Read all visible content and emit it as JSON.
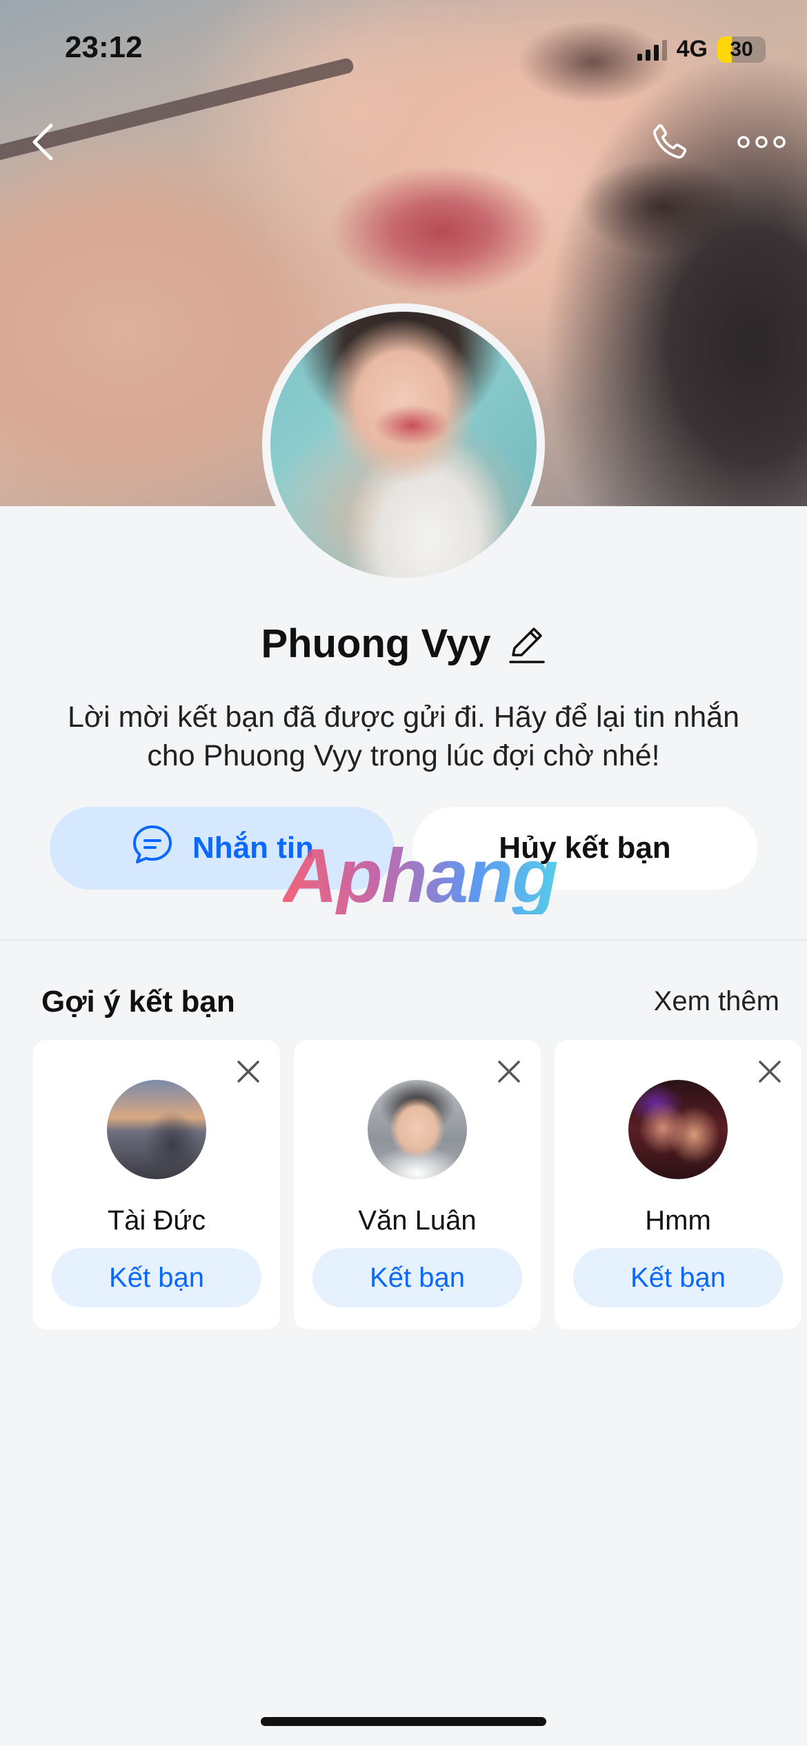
{
  "status_bar": {
    "time": "23:12",
    "network": "4G",
    "battery": "30"
  },
  "profile": {
    "name": "Phuong Vyy",
    "message": "Lời mời kết bạn đã được gửi đi. Hãy để lại tin nhắn cho Phuong Vyy trong lúc đợi chờ nhé!",
    "message_button_label": "Nhắn tin",
    "unfriend_button_label": "Hủy kết bạn"
  },
  "watermark": "Aphang",
  "suggestions": {
    "title": "Gợi ý kết bạn",
    "see_more": "Xem thêm",
    "items": [
      {
        "name": "Tài Đức",
        "button_label": "Kết bạn"
      },
      {
        "name": "Văn Luân",
        "button_label": "Kết bạn"
      },
      {
        "name": "Hmm",
        "button_label": "Kết bạn"
      }
    ]
  },
  "icons": {
    "back": "chevron-left-icon",
    "call": "phone-icon",
    "more": "more-horizontal-icon",
    "edit": "pencil-icon",
    "chat": "chat-bubble-icon",
    "dismiss": "close-icon"
  },
  "colors": {
    "accent": "#0a68ff",
    "primary_button_bg": "#d6e8fd",
    "suggestion_button_bg": "#e6f1fe",
    "background": "#f4f5f7"
  }
}
